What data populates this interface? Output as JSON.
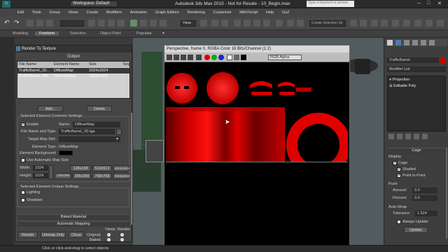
{
  "app": {
    "title": "Autodesk 3ds Max 2015 - Not for Resale -  10_Begin.max",
    "workspace": "Workspace: Default",
    "search_placeholder": "Type a keyword or phrase"
  },
  "menu": [
    "Edit",
    "Tools",
    "Group",
    "Views",
    "Create",
    "Modifiers",
    "Animation",
    "Graph Editors",
    "Rendering",
    "Customize",
    "MAXScript",
    "Help",
    "GoZ"
  ],
  "toolbar": {
    "view_dropdown": "View",
    "selection_set": "Create Selection Se"
  },
  "ribbon": {
    "tabs": [
      "Modeling",
      "Freeform",
      "Selection",
      "Object Paint",
      "Populate"
    ],
    "active": "Freeform"
  },
  "render_to_texture": {
    "title": "Render To Texture",
    "output_header": "Output",
    "columns": [
      "File Name",
      "Element Name",
      "Size",
      "Targ"
    ],
    "rows": [
      {
        "file": "TrafficBarrel_JD...",
        "element": "DiffuseMap",
        "size": "1024x1024",
        "target": ""
      },
      {
        "file": "TrafficBarrel_NM...",
        "element": "NormalsMap",
        "size": "1024x1024",
        "target": ""
      }
    ],
    "add_button": "Add...",
    "delete_button": "Delete",
    "common_settings_title": "Selected Element Common Settings",
    "enable_label": "Enable",
    "name_label": "Name:",
    "name_value": "DiffuseMap",
    "file_type_label": "File Name and Type:",
    "file_type_value": "TrafficBarrel_JD.tga",
    "target_slot_label": "Target Map Slot:",
    "element_type_label": "Element Type:",
    "element_type_value": "DiffuseMap",
    "element_bg_label": "Element Background:",
    "auto_map_size_label": "Use Automatic Map Size",
    "width_label": "Width:",
    "width_value": "1024",
    "height_label": "Height:",
    "height_value": "1024",
    "size_buttons": [
      "128x128",
      "512x512",
      "1024x1024",
      "128x256",
      "256x256",
      "768x768",
      "2048x2048"
    ],
    "unique_settings_title": "Selected Element Unique Settings",
    "lighting_label": "Lighting",
    "shadows_label": "Shadows",
    "baked_material_bar": "Baked Material",
    "automatic_mapping_bar": "Automatic Mapping",
    "bottom": {
      "render": "Render",
      "unwrap_only": "Unwrap Only",
      "close": "Close",
      "original": "Original:",
      "baked": "Baked",
      "views_label": "Views",
      "render_label": "Render"
    }
  },
  "render_frame": {
    "title": "Perspective, frame 0, RGBA Color 16 Bits/Channel (1:2)",
    "channel_dropdown": "RGB Alpha"
  },
  "modify_panel": {
    "object_name": "TrafficBarrel",
    "modifier_list": "Modifier List",
    "stack": [
      "Projection",
      "Editable Poly"
    ],
    "cage_title": "Cage",
    "display_label": "Display",
    "cage_check": "Cage",
    "shaded_check": "Shaded",
    "point_to_point_check": "Point to Point",
    "push_label": "Push",
    "amount_label": "Amount:",
    "amount_value": "0.0",
    "percent_label": "Percent:",
    "percent_value": "0.0",
    "auto_wrap_label": "Auto-Wrap",
    "tolerance_label": "Tolerance:",
    "tolerance_value": "1.524",
    "always_update": "Always Update",
    "update_button": "Update"
  },
  "status": {
    "text": "Click or click-and-drag to select objects"
  },
  "colors": {
    "accent_red": "#e30000",
    "panel": "#454545"
  }
}
